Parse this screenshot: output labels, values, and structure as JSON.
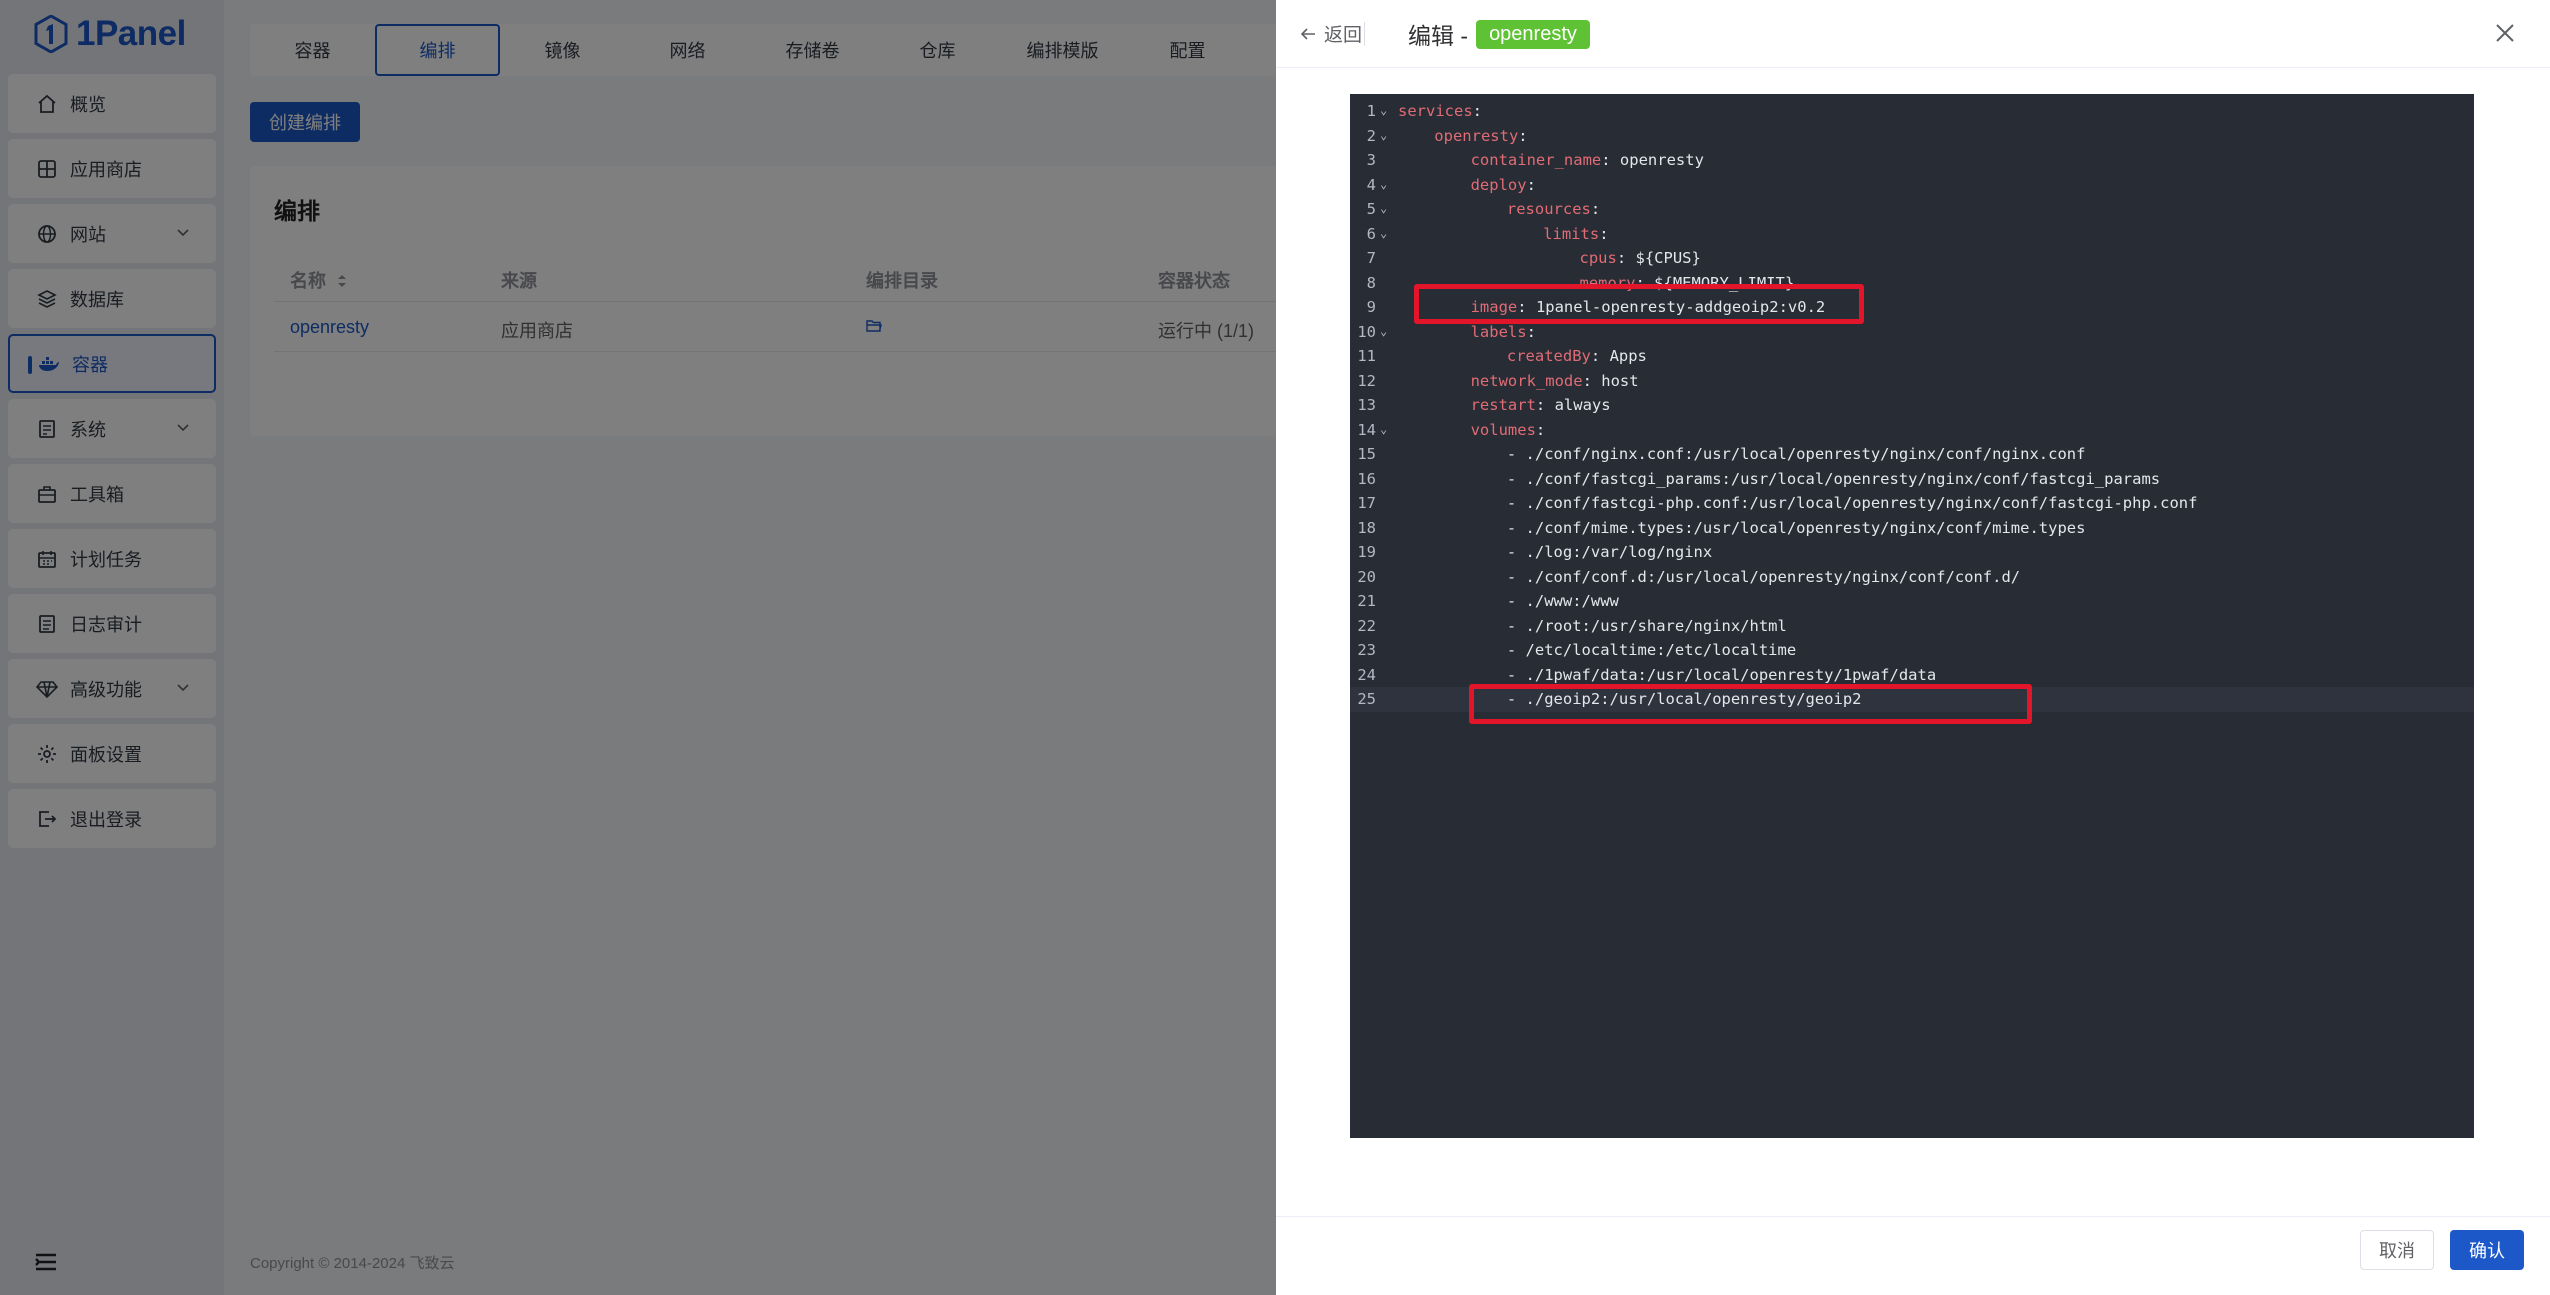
{
  "app": {
    "logo_text": "1Panel"
  },
  "sidebar": {
    "items": [
      {
        "label": "概览",
        "icon": "home-icon"
      },
      {
        "label": "应用商店",
        "icon": "grid-icon"
      },
      {
        "label": "网站",
        "icon": "globe-icon",
        "expandable": true
      },
      {
        "label": "数据库",
        "icon": "layers-icon"
      },
      {
        "label": "容器",
        "icon": "docker-icon",
        "active": true
      },
      {
        "label": "系统",
        "icon": "server-icon",
        "expandable": true
      },
      {
        "label": "工具箱",
        "icon": "toolbox-icon"
      },
      {
        "label": "计划任务",
        "icon": "calendar-icon"
      },
      {
        "label": "日志审计",
        "icon": "log-icon"
      },
      {
        "label": "高级功能",
        "icon": "diamond-icon",
        "expandable": true
      },
      {
        "label": "面板设置",
        "icon": "gear-icon"
      },
      {
        "label": "退出登录",
        "icon": "logout-icon"
      }
    ]
  },
  "tabs": [
    {
      "label": "容器"
    },
    {
      "label": "编排",
      "active": true
    },
    {
      "label": "镜像"
    },
    {
      "label": "网络"
    },
    {
      "label": "存储卷"
    },
    {
      "label": "仓库"
    },
    {
      "label": "编排模版"
    },
    {
      "label": "配置"
    }
  ],
  "main": {
    "create_button": "创建编排",
    "panel_title": "编排",
    "table": {
      "headers": [
        "名称",
        "来源",
        "编排目录",
        "容器状态"
      ],
      "rows": [
        {
          "name": "openresty",
          "source": "应用商店",
          "status": "运行中 (1/1)"
        }
      ]
    },
    "copyright": "Copyright © 2014-2024 飞致云"
  },
  "drawer": {
    "back_label": "返回",
    "title_prefix": "编辑 -",
    "title_tag": "openresty",
    "tag_color": "#5ec234",
    "cancel_label": "取消",
    "confirm_label": "确认"
  },
  "editor": {
    "highlight_color": "#e3152b",
    "lines": [
      {
        "n": "1",
        "fold": true,
        "key": "services",
        "sep": ":",
        "val": ""
      },
      {
        "n": "2",
        "fold": true,
        "key": "openresty",
        "sep": ":",
        "val": ""
      },
      {
        "n": "3",
        "fold": false,
        "key": "container_name",
        "sep": ":",
        "val": " openresty"
      },
      {
        "n": "4",
        "fold": true,
        "key": "deploy",
        "sep": ":",
        "val": ""
      },
      {
        "n": "5",
        "fold": true,
        "key": "resources",
        "sep": ":",
        "val": ""
      },
      {
        "n": "6",
        "fold": true,
        "key": "limits",
        "sep": ":",
        "val": ""
      },
      {
        "n": "7",
        "fold": false,
        "key": "cpus",
        "sep": ":",
        "val": " ${CPUS}"
      },
      {
        "n": "8",
        "fold": false,
        "key": "memory",
        "sep": ":",
        "val": " ${MEMORY_LIMIT}"
      },
      {
        "n": "9",
        "fold": false,
        "key": "image",
        "sep": ":",
        "val": " 1panel-openresty-addgeoip2:v0.2"
      },
      {
        "n": "10",
        "fold": true,
        "key": "labels",
        "sep": ":",
        "val": ""
      },
      {
        "n": "11",
        "fold": false,
        "key": "createdBy",
        "sep": ":",
        "val": " Apps"
      },
      {
        "n": "12",
        "fold": false,
        "key": "network_mode",
        "sep": ":",
        "val": " host"
      },
      {
        "n": "13",
        "fold": false,
        "key": "restart",
        "sep": ":",
        "val": " always"
      },
      {
        "n": "14",
        "fold": true,
        "key": "volumes",
        "sep": ":",
        "val": ""
      },
      {
        "n": "15",
        "fold": false,
        "key": "",
        "sep": "",
        "val": "- ./conf/nginx.conf:/usr/local/openresty/nginx/conf/nginx.conf"
      },
      {
        "n": "16",
        "fold": false,
        "key": "",
        "sep": "",
        "val": "- ./conf/fastcgi_params:/usr/local/openresty/nginx/conf/fastcgi_params"
      },
      {
        "n": "17",
        "fold": false,
        "key": "",
        "sep": "",
        "val": "- ./conf/fastcgi-php.conf:/usr/local/openresty/nginx/conf/fastcgi-php.conf"
      },
      {
        "n": "18",
        "fold": false,
        "key": "",
        "sep": "",
        "val": "- ./conf/mime.types:/usr/local/openresty/nginx/conf/mime.types"
      },
      {
        "n": "19",
        "fold": false,
        "key": "",
        "sep": "",
        "val": "- ./log:/var/log/nginx"
      },
      {
        "n": "20",
        "fold": false,
        "key": "",
        "sep": "",
        "val": "- ./conf/conf.d:/usr/local/openresty/nginx/conf/conf.d/"
      },
      {
        "n": "21",
        "fold": false,
        "key": "",
        "sep": "",
        "val": "- ./www:/www"
      },
      {
        "n": "22",
        "fold": false,
        "key": "",
        "sep": "",
        "val": "- ./root:/usr/share/nginx/html"
      },
      {
        "n": "23",
        "fold": false,
        "key": "",
        "sep": "",
        "val": "- /etc/localtime:/etc/localtime"
      },
      {
        "n": "24",
        "fold": false,
        "key": "",
        "sep": "",
        "val": "- ./1pwaf/data:/usr/local/openresty/1pwaf/data"
      },
      {
        "n": "25",
        "fold": false,
        "key": "",
        "sep": "",
        "val": "- ./geoip2:/usr/local/openresty/geoip2"
      }
    ]
  }
}
